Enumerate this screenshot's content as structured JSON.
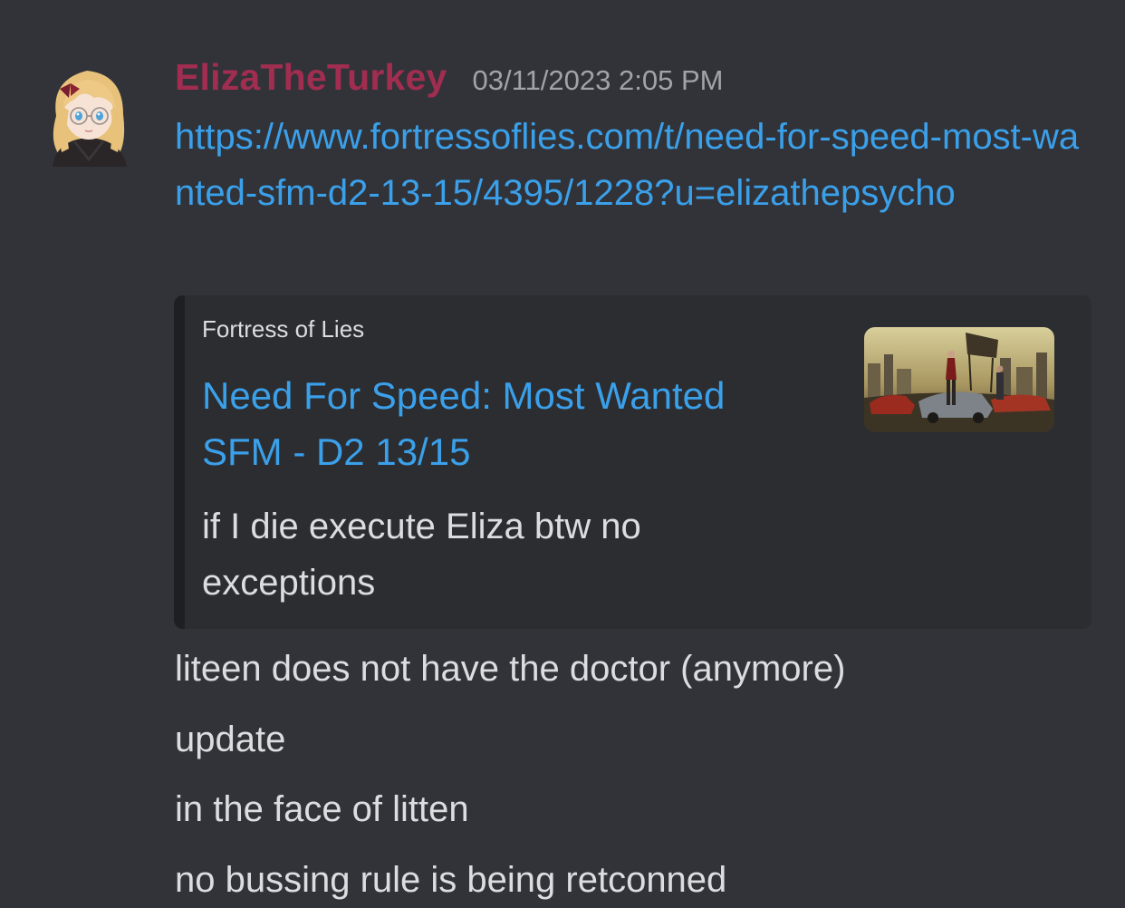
{
  "message": {
    "username": "ElizaTheTurkey",
    "timestamp": "03/11/2023 2:05 PM",
    "link": "https://www.fortressoflies.com/t/need-for-speed-most-wanted-sfm-d2-13-15/4395/1228?u=elizathepsycho",
    "embed": {
      "provider": "Fortress of Lies",
      "title": "Need For Speed: Most Wanted SFM - D2 13/15",
      "description": "if I die execute Eliza btw no exceptions"
    },
    "lines": [
      "liteen does not have the doctor (anymore)",
      "update",
      "in the face of litten",
      "no bussing rule is being retconned"
    ]
  },
  "colors": {
    "background": "#313338",
    "embed_background": "#2b2d31",
    "username": "#a12d50",
    "link": "#3ba0ea",
    "text": "#dbdee1",
    "timestamp": "#a0a3a9"
  }
}
